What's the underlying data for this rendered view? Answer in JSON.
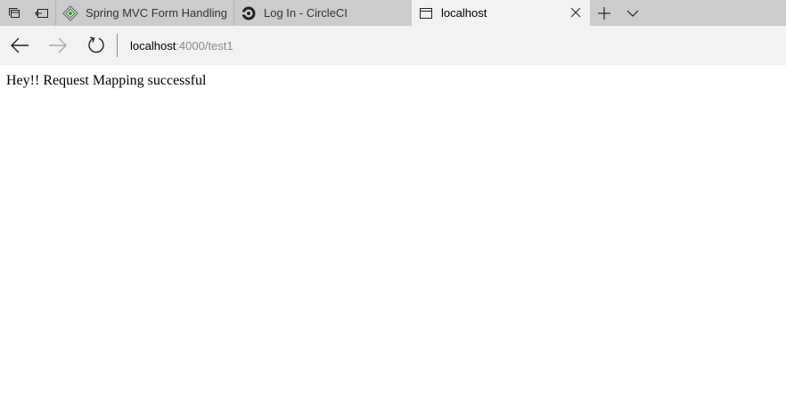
{
  "tabs": [
    {
      "title": "Spring MVC Form Handling",
      "icon": "spring-diamond-icon",
      "active": false
    },
    {
      "title": "Log In - CircleCI",
      "icon": "circleci-icon",
      "active": false
    },
    {
      "title": "localhost",
      "icon": "page-icon",
      "active": true
    }
  ],
  "address_bar": {
    "host": "localhost",
    "path": ":4000/test1"
  },
  "page": {
    "message": "Hey!! Request Mapping successful"
  },
  "colors": {
    "tabstrip": "#cccccc",
    "active_tab": "#f2f2f2",
    "url_path": "#8a8a8a"
  }
}
